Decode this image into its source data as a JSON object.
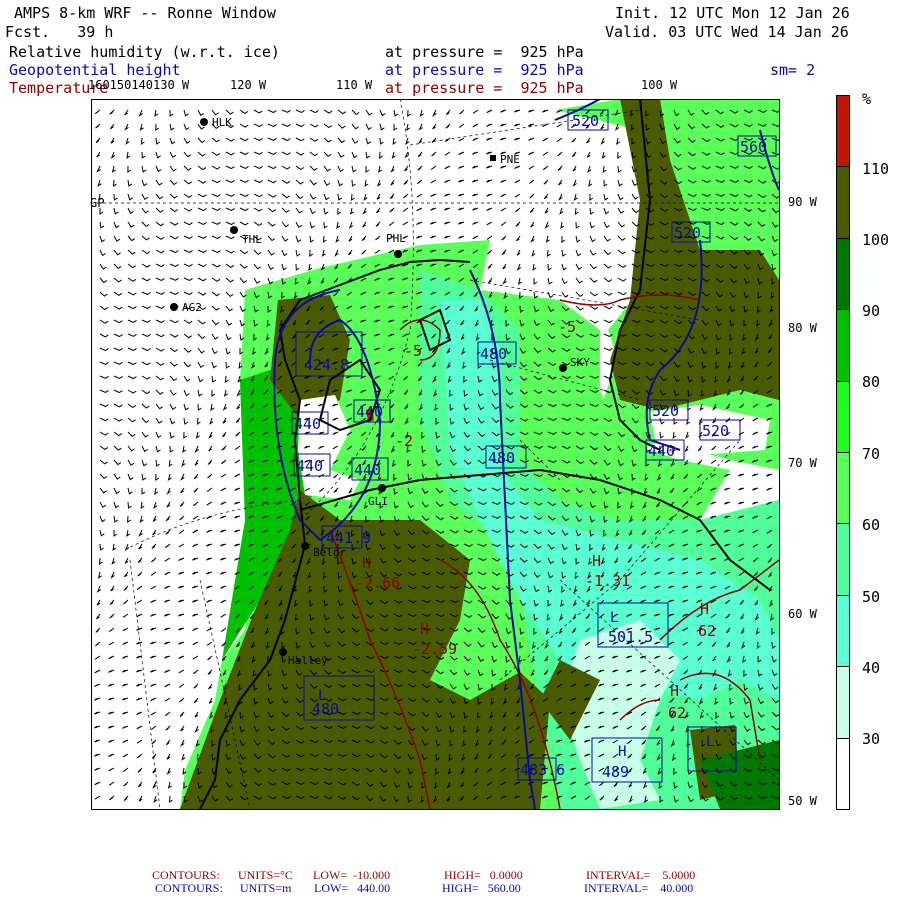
{
  "header": {
    "title": "AMPS 8-km WRF -- Ronne Window",
    "forecast": "Fcst.   39 h",
    "init": "Init. 12 UTC Mon 12 Jan 26",
    "valid": "Valid. 03 UTC Wed 14 Jan 26",
    "fields": [
      {
        "name": "Relative humidity (w.r.t. ice)",
        "level": "at pressure =  925 hPa",
        "color": "#000000"
      },
      {
        "name": "Geopotential height",
        "level": "at pressure =  925 hPa",
        "color": "#0a0a9a"
      },
      {
        "name": "Temperature",
        "level": "at pressure =  925 hPa",
        "color": "#8a0000"
      }
    ],
    "smoothing": "sm= 2"
  },
  "axes": {
    "top_lon_labels": [
      "160150140130 W",
      "120 W",
      "110 W",
      "100 W"
    ],
    "right_labels": [
      "90 W",
      "80 W",
      "70 W",
      "60 W",
      "50 W"
    ],
    "left_label": "GP"
  },
  "stations": [
    "HLK",
    "PNE",
    "THL",
    "PHL",
    "AG2",
    "SKY",
    "GLI",
    "Belgr",
    "Halley"
  ],
  "height_labels": [
    "520",
    "560",
    "520",
    "424.8",
    "440",
    "440",
    "440",
    "440",
    "480",
    "480",
    "520",
    "520",
    "440",
    "441.9",
    "480",
    "483.6",
    "501.5",
    "489"
  ],
  "temperature_labels": [
    "-2.66",
    "-1.31",
    "-2.59",
    "-5",
    "62",
    "62",
    "-2",
    "-5"
  ],
  "colorbar": {
    "unit": "%",
    "ticks": [
      "110",
      "100",
      "90",
      "80",
      "70",
      "60",
      "50",
      "40",
      "30"
    ],
    "colors": [
      "#c01800",
      "#4a5a00",
      "#007800",
      "#00c000",
      "#1eff1e",
      "#5aff5a",
      "#50ff9a",
      "#5affd2",
      "#c8ffe8",
      "#ffffff"
    ]
  },
  "footer": {
    "temp": {
      "label": "CONTOURS:",
      "units": "UNITS=°C",
      "low": "LOW=  -10.000",
      "high": "HIGH=   0.0000",
      "interval": "INTERVAL=    5.0000"
    },
    "height": {
      "label": "CONTOURS:",
      "units": "UNITS=m",
      "low": "LOW=   440.00",
      "high": "HIGH=   560.00",
      "interval": "INTERVAL=    40.000"
    }
  }
}
